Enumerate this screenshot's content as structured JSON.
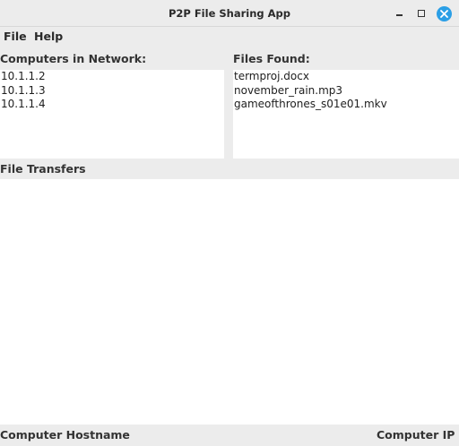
{
  "window": {
    "title": "P2P File Sharing App",
    "close_color": "#2b9fe6"
  },
  "menu": {
    "items": [
      "File",
      "Help"
    ]
  },
  "computers": {
    "label": "Computers in Network:",
    "items": [
      "10.1.1.2",
      "10.1.1.3",
      "10.1.1.4"
    ]
  },
  "files": {
    "label": "Files Found:",
    "items": [
      "termproj.docx",
      "november_rain.mp3",
      "gameofthrones_s01e01.mkv"
    ]
  },
  "transfers": {
    "label": "File Transfers"
  },
  "table": {
    "columns": [
      "Computer Hostname",
      "Computer IP"
    ]
  }
}
